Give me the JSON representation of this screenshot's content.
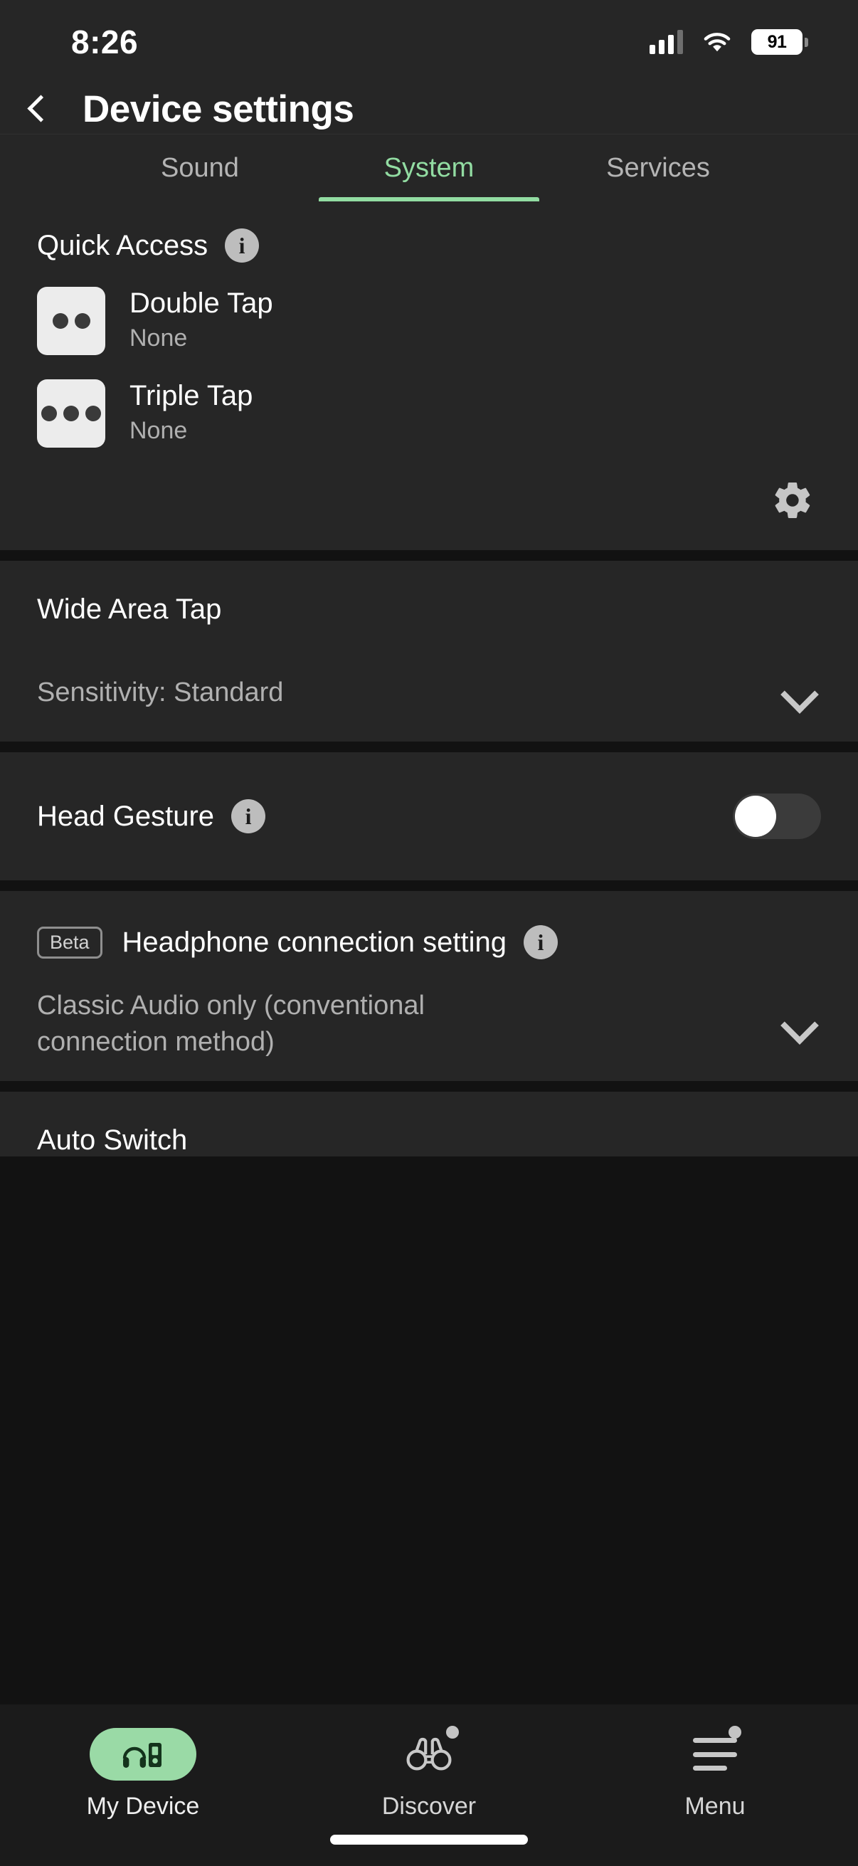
{
  "status_bar": {
    "time": "8:26",
    "signal_icon": "signal-bars-icon",
    "wifi_icon": "wifi-icon",
    "battery_level": "91"
  },
  "header": {
    "back_icon": "chevron-left-icon",
    "title": "Device settings"
  },
  "tabs": [
    {
      "label": "Sound",
      "active": false
    },
    {
      "label": "System",
      "active": true
    },
    {
      "label": "Services",
      "active": false
    }
  ],
  "accent_color": "#92dca2",
  "sections": {
    "quick_access": {
      "title": "Quick Access",
      "info_icon": "info-icon",
      "info_glyph": "i",
      "rows": [
        {
          "icon": "double-tap-icon",
          "title": "Double Tap",
          "value": "None"
        },
        {
          "icon": "triple-tap-icon",
          "title": "Triple Tap",
          "value": "None"
        }
      ],
      "settings_icon": "gear-icon"
    },
    "wide_area_tap": {
      "title": "Wide Area Tap",
      "selected": "Sensitivity: Standard",
      "chevron_icon": "chevron-down-icon"
    },
    "head_gesture": {
      "title": "Head Gesture",
      "info_icon": "info-icon",
      "info_glyph": "i",
      "toggle_state": "off"
    },
    "headphone_connection": {
      "badge": "Beta",
      "title": "Headphone connection setting",
      "info_icon": "info-icon",
      "info_glyph": "i",
      "selected": "Classic Audio only (conventional connection method)",
      "chevron_icon": "chevron-down-icon"
    },
    "auto_switch": {
      "title": "Auto Switch"
    }
  },
  "bottom_nav": [
    {
      "label": "My Device",
      "icon": "headphones-device-icon",
      "active": true,
      "badge": false
    },
    {
      "label": "Discover",
      "icon": "binoculars-icon",
      "active": false,
      "badge": true
    },
    {
      "label": "Menu",
      "icon": "hamburger-menu-icon",
      "active": false,
      "badge": true
    }
  ]
}
